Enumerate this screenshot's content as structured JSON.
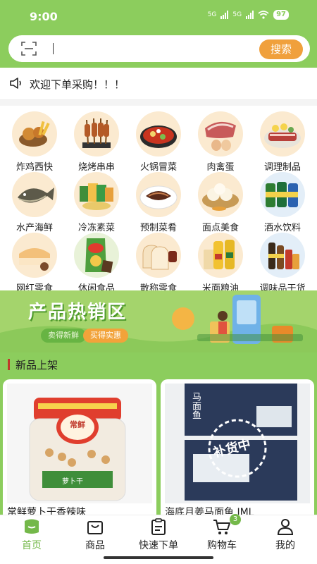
{
  "status_bar": {
    "time": "9:00",
    "net1": "5G",
    "net2": "5G",
    "battery": "97"
  },
  "search": {
    "placeholder": "",
    "value": "",
    "button_label": "搜索"
  },
  "notice": {
    "text": "欢迎下单采购！！！"
  },
  "categories": [
    {
      "label": "炸鸡西快",
      "icon": "fried-chicken"
    },
    {
      "label": "烧烤串串",
      "icon": "bbq-skewers"
    },
    {
      "label": "火锅冒菜",
      "icon": "hotpot"
    },
    {
      "label": "肉禽蛋",
      "icon": "meat-eggs"
    },
    {
      "label": "调理制品",
      "icon": "prepared-meat"
    },
    {
      "label": "水产海鲜",
      "icon": "fish"
    },
    {
      "label": "冷冻素菜",
      "icon": "frozen-veg"
    },
    {
      "label": "预制菜肴",
      "icon": "dish"
    },
    {
      "label": "面点美食",
      "icon": "buns"
    },
    {
      "label": "酒水饮料",
      "icon": "drinks"
    },
    {
      "label": "网红零食",
      "icon": "snacks"
    },
    {
      "label": "休闲食品",
      "icon": "chips"
    },
    {
      "label": "散称零食",
      "icon": "bread"
    },
    {
      "label": "米面粮油",
      "icon": "oil-rice"
    },
    {
      "label": "调味品干货",
      "icon": "condiments"
    }
  ],
  "banner": {
    "title": "产品热销区",
    "tag1": "卖得新鲜",
    "tag2": "买得实惠"
  },
  "new_section": {
    "title": "新品上架"
  },
  "products": [
    {
      "name": "常鲜萝卜干香辣味",
      "jar_label": "常鲜",
      "jar_sub": "萝卜干"
    },
    {
      "name": "海底月姜马面鱼 JML",
      "pack_text": "马面鱼",
      "stamp": "补货中"
    }
  ],
  "tabs": [
    {
      "label": "首页",
      "icon": "home-icon",
      "active": true
    },
    {
      "label": "商品",
      "icon": "bag-icon"
    },
    {
      "label": "快速下单",
      "icon": "clipboard-icon"
    },
    {
      "label": "购物车",
      "icon": "cart-icon",
      "badge": "3"
    },
    {
      "label": "我的",
      "icon": "user-icon"
    }
  ],
  "colors": {
    "brand": "#8ccd5d",
    "accent": "#f0a03c",
    "active_tab": "#74b84a"
  }
}
